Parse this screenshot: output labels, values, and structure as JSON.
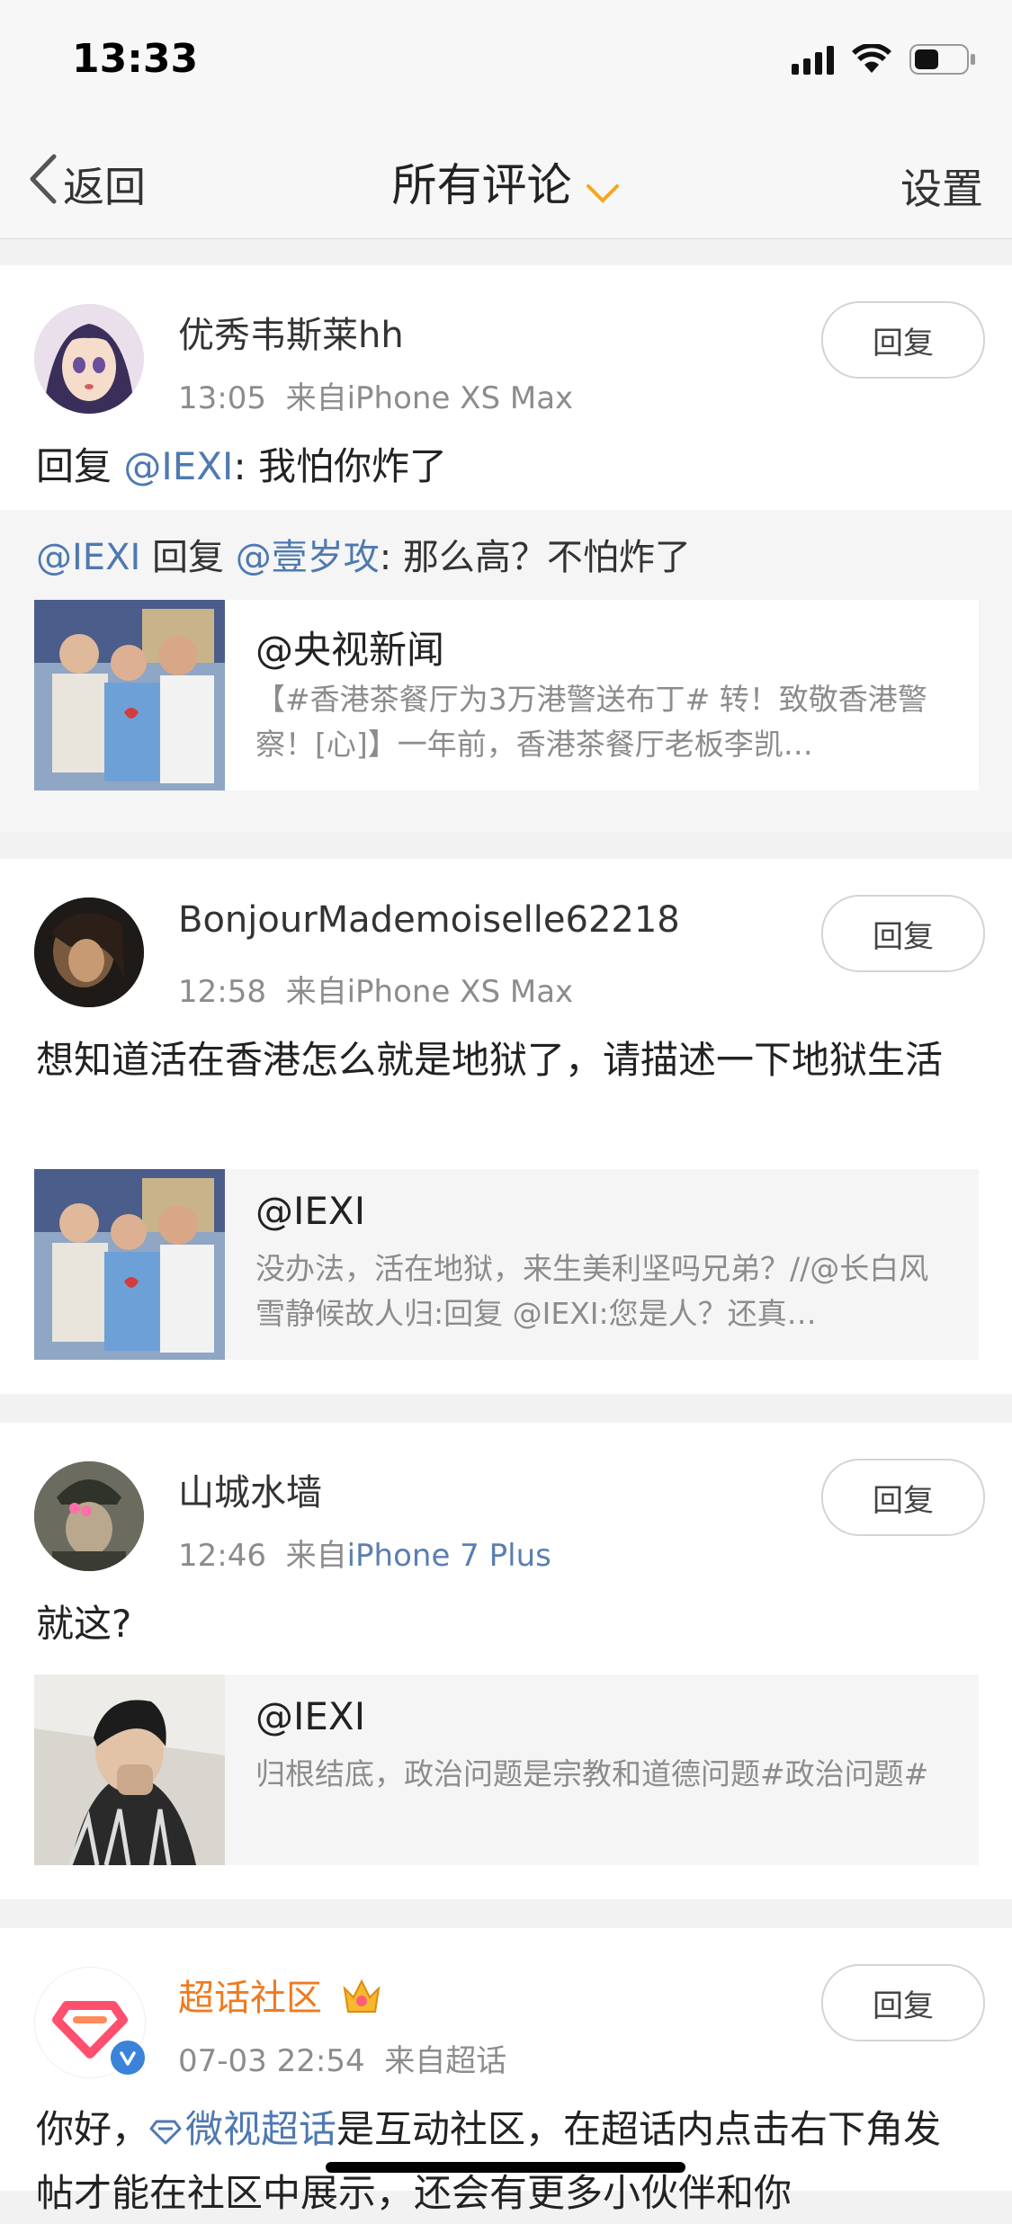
{
  "status": {
    "time": "13:33"
  },
  "nav": {
    "back_label": "返回",
    "title": "所有评论",
    "settings_label": "设置"
  },
  "reply_label": "回复",
  "comments": [
    {
      "username": "优秀韦斯莱hh",
      "time": "13:05",
      "source": "来自iPhone XS Max",
      "text_prefix": "回复 ",
      "text_mention": "@IEXI",
      "text_suffix": ": 我怕你炸了",
      "quote": {
        "mention1": "@IEXI",
        "mid": " 回复 ",
        "mention2": "@壹岁攻",
        "text": ": 那么高？不怕炸了"
      },
      "ref": {
        "title": "@央视新闻",
        "desc": "【#香港茶餐厅为3万港警送布丁# 转！致敬香港警察！[心]】一年前，香港茶餐厅老板李凯…"
      }
    },
    {
      "username": "BonjourMademoiselle62218",
      "time": "12:58",
      "source": "来自iPhone XS Max",
      "text": "想知道活在香港怎么就是地狱了，请描述一下地狱生活",
      "ref": {
        "title": "@IEXI",
        "desc": "没办法，活在地狱，来生美利坚吗兄弟？//@长白风雪静候故人归:回复 @IEXI:您是人？还真…"
      }
    },
    {
      "username": "山城水墙",
      "time": "12:46",
      "source_prefix": "来自",
      "source_link": "iPhone 7 Plus",
      "text": "就这?",
      "ref": {
        "title": "@IEXI",
        "desc": "归根结底，政治问题是宗教和道德问题#政治问题#"
      }
    },
    {
      "username": "超话社区",
      "time": "07-03 22:54",
      "source": "来自超话",
      "text_prefix": "你好，",
      "text_link": "微视超话",
      "text_suffix": "是互动社区，在超话内点击右下角发帖才能在社区中展示，还会有更多小伙伴和你"
    }
  ],
  "colors": {
    "link": "#4f79b0",
    "orange_name": "#f07a1e",
    "accent_chevron": "#f5a623"
  }
}
